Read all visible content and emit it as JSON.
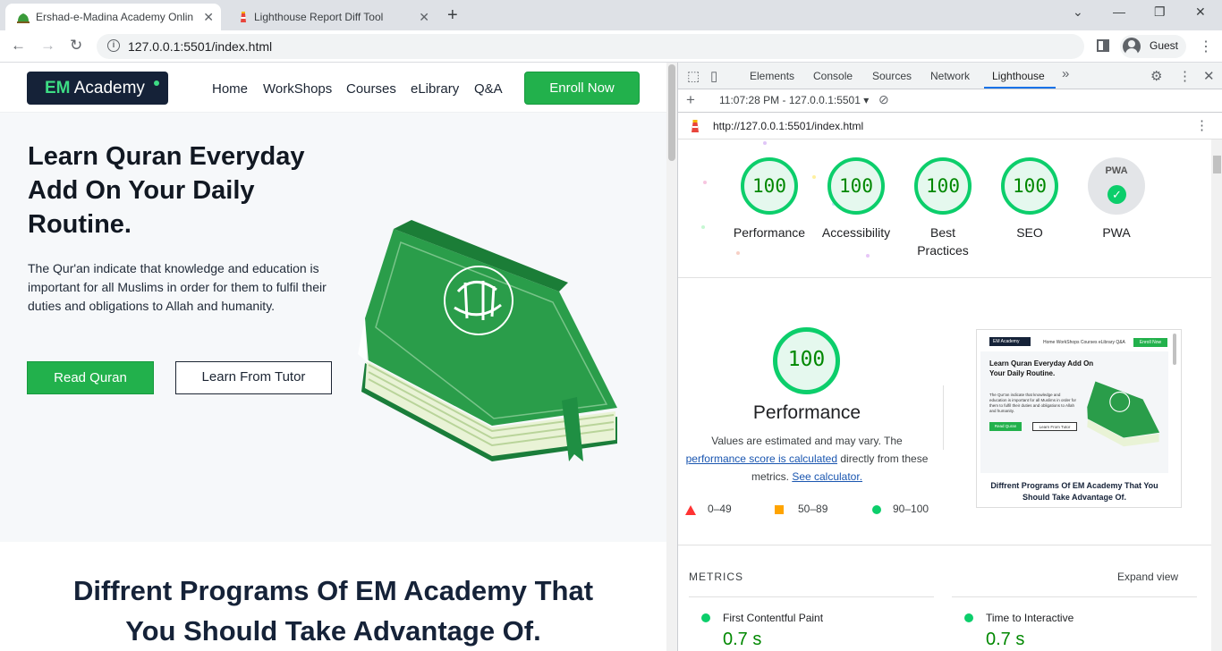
{
  "browser": {
    "tabs": [
      {
        "title": "Ershad-e-Madina Academy Onlin",
        "close": "✕"
      },
      {
        "title": "Lighthouse Report Diff Tool",
        "close": "✕"
      }
    ],
    "new_tab": "+",
    "url": "127.0.0.1:5501/index.html",
    "profile_name": "Guest"
  },
  "site": {
    "logo": {
      "em": "EM",
      "rest": " Academy"
    },
    "nav": [
      "Home",
      "WorkShops",
      "Courses",
      "eLibrary",
      "Q&A"
    ],
    "enroll": "Enroll Now",
    "hero": {
      "title": "Learn Quran Everyday Add On Your Daily Routine.",
      "text": "The Qur'an indicate that knowledge and education is important for all Muslims in order for them to fulfil their duties and obligations to Allah and humanity.",
      "primary_btn": "Read Quran",
      "secondary_btn": "Learn From Tutor"
    },
    "programs_title": "Diffrent Programs Of EM Academy That You Should Take Advantage Of."
  },
  "devtools": {
    "tabs": [
      "Elements",
      "Console",
      "Sources",
      "Network",
      "Lighthouse"
    ],
    "active_tab": "Lighthouse",
    "more": "»",
    "report_select": "11:07:28 PM - 127.0.0.1:5501 ▾",
    "report_url": "http://127.0.0.1:5501/index.html",
    "scores": [
      {
        "label": "Performance",
        "value": "100"
      },
      {
        "label": "Accessibility",
        "value": "100"
      },
      {
        "label": "Best Practices",
        "value": "100"
      },
      {
        "label": "SEO",
        "value": "100"
      },
      {
        "label": "PWA",
        "value": "PWA"
      }
    ],
    "performance": {
      "score": "100",
      "title": "Performance",
      "desc_start": "Values are estimated and may vary. The ",
      "desc_link": "performance score is calculated",
      "desc_mid": " directly from these metrics. ",
      "desc_link2": "See calculator.",
      "legend": [
        "0–49",
        "50–89",
        "90–100"
      ]
    },
    "thumbnail": {
      "logo": "EM Academy",
      "links": "Home  WorkShops  Courses  eLibrary  Q&A",
      "enroll": "Enroll Now",
      "title": "Learn Quran Everyday Add On Your Daily Routine.",
      "text": "The Qur'an indicate that knowledge and education is important for all Muslims in order for them to fulfil their duties and obligations to Allah and humanity.",
      "read": "Read Quran",
      "tutor": "Learn From Tutor",
      "programs": "Diffrent Programs Of EM Academy That You Should Take Advantage Of."
    },
    "metrics_heading": "METRICS",
    "expand_view": "Expand view",
    "metrics": [
      {
        "name": "First Contentful Paint",
        "value": "0.7 s"
      },
      {
        "name": "Time to Interactive",
        "value": "0.7 s"
      }
    ]
  },
  "colors": {
    "accent_green": "#22b14c",
    "lighthouse_pass": "#0cce6b",
    "navy": "#152238"
  }
}
